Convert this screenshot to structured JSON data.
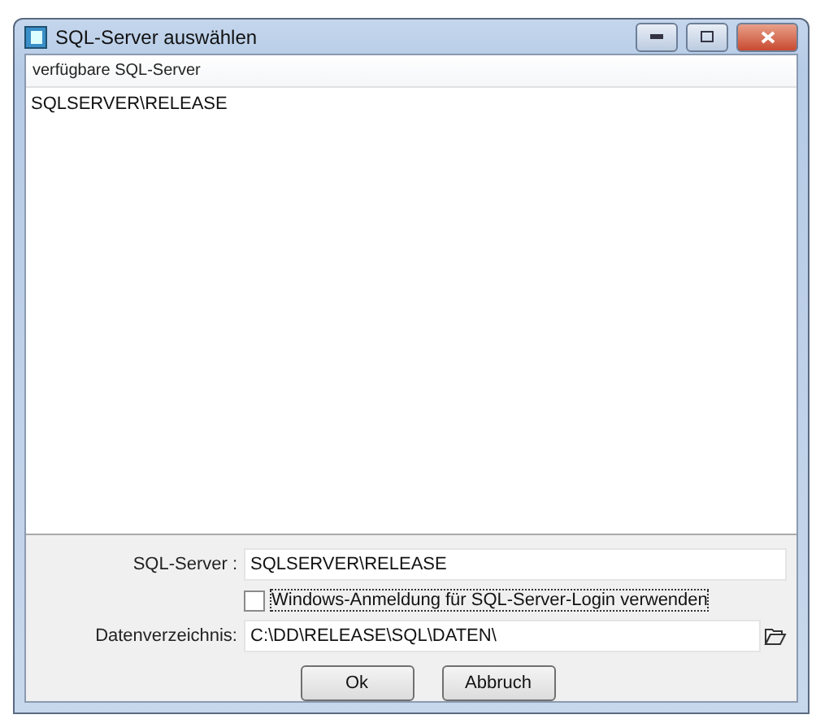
{
  "window": {
    "title": "SQL-Server auswählen"
  },
  "server_list": {
    "header": "verfügbare SQL-Server",
    "items": [
      {
        "label": "SQLSERVER\\RELEASE",
        "selected": false
      }
    ]
  },
  "form": {
    "server_label": "SQL-Server :",
    "server_value": "SQLSERVER\\RELEASE",
    "windows_login": {
      "label": "Windows-Anmeldung für SQL-Server-Login verwenden",
      "checked": false
    },
    "directory_label": "Datenverzeichnis:",
    "directory_value": "C:\\DD\\RELEASE\\SQL\\DATEN\\"
  },
  "buttons": [
    "Ok",
    "Abbruch"
  ]
}
